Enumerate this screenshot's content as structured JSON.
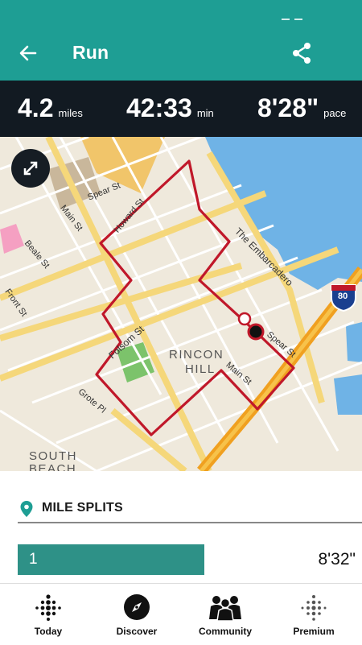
{
  "header": {
    "title": "Run",
    "back_icon": "arrow-left-icon",
    "share_icon": "share-icon",
    "color": "#1e9e94"
  },
  "stats": {
    "distance": {
      "value": "4.2",
      "unit": "miles"
    },
    "duration": {
      "value": "42:33",
      "unit": "min"
    },
    "pace": {
      "value": "8'28\"",
      "unit": "pace"
    }
  },
  "map": {
    "labels": {
      "spear": "Spear St",
      "main": "Main St",
      "beale": "Beale St",
      "howard": "Howard St",
      "embarcadero": "The Embarcadero",
      "folsom": "Folsom St",
      "rincon1": "RINCON",
      "rincon2": "HILL",
      "grote": "Grote Pl",
      "south1": "SOUTH",
      "south2": "BEACH",
      "main2": "Main St",
      "spear2": "Spear St",
      "front": "Front St",
      "highway": "80"
    },
    "route_color": "#c0182a",
    "expand_icon": "expand-arrows-icon"
  },
  "splits": {
    "heading": "MILE SPLITS",
    "pin_icon": "location-pin-icon",
    "rows": [
      {
        "mile": "1",
        "time": "8'32\"",
        "fill_fraction": 0.54
      }
    ]
  },
  "nav": [
    {
      "label": "Today",
      "icon": "dots-grid-icon"
    },
    {
      "label": "Discover",
      "icon": "compass-icon"
    },
    {
      "label": "Community",
      "icon": "people-icon"
    },
    {
      "label": "Premium",
      "icon": "dots-premium-icon"
    }
  ]
}
